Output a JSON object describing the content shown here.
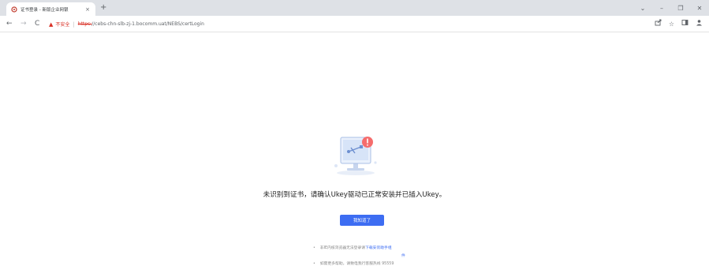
{
  "browser": {
    "tab_title": "证书登录 - 新版企业网银",
    "tab_close": "×",
    "new_tab": "+",
    "window_controls": [
      "⌄",
      "–",
      "❐",
      "✕"
    ],
    "nav": {
      "back": "←",
      "forward": "→",
      "reload": "C"
    },
    "security_label": "不安全",
    "url_scheme": "https:",
    "url_rest": "//cebs-chn-slb-zj-1.bocomm.uat/NEBS/certLogin",
    "toolbar_icons": [
      "share-icon",
      "star-icon",
      "sidepanel-icon",
      "profile-icon"
    ]
  },
  "page": {
    "message": "未识别到证书，请确认Ukey驱动已正常安装并已插入Ukey。",
    "ok_button_label": "我知道了",
    "tips": {
      "line1_text": "非IE内核浏览器无法登录请",
      "line1_link": "下载安装助手组",
      "line1_link_wrap": "件",
      "line2_text": "如需更多帮助，请致电我行客服热线 95559"
    }
  },
  "colors": {
    "accent": "#3d6df2",
    "warning": "#d93025",
    "badge": "#f56c6c"
  }
}
